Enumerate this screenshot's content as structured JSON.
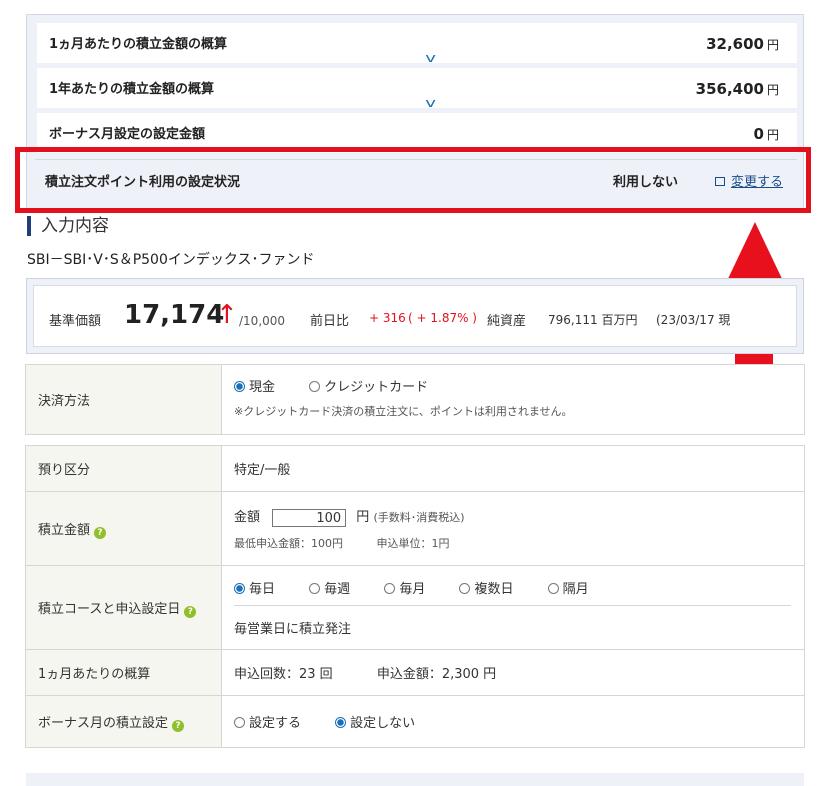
{
  "summary": {
    "monthly_label": "1ヵ月あたりの積立金額の概算",
    "monthly_value": "32,600",
    "yearly_label": "1年あたりの積立金額の概算",
    "yearly_value": "356,400",
    "bonus_label": "ボーナス月設定の設定金額",
    "bonus_value": "0",
    "yen": "円",
    "point_label": "積立注文ポイント利用の設定状況",
    "point_value": "利用しない",
    "point_link": "変更する"
  },
  "section": {
    "title": "入力内容",
    "fund_name": "SBI－SBI･V･S＆P500インデックス･ファンド"
  },
  "price": {
    "nav_label": "基準価額",
    "nav_value": "17,174",
    "arrow": "↑",
    "unit": "/10,000",
    "change_label": "前日比",
    "change_value": "+ 316",
    "change_pct": "( + 1.87% )",
    "assets_label": "純資産",
    "assets_value": "796,111 百万円",
    "date": "(23/03/17 現"
  },
  "payment": {
    "label": "決済方法",
    "opt_cash": "現金",
    "opt_card": "クレジットカード",
    "note": "※クレジットカード決済の積立注文に、ポイントは利用されません。"
  },
  "form": {
    "account_label": "預り区分",
    "account_value": "特定/一般",
    "amount_label": "積立金額",
    "amount_prefix": "金額",
    "amount_value": "100",
    "amount_suffix": "円",
    "amount_tax": "(手数料･消費税込)",
    "min_amount": "最低申込金額：100円",
    "unit_amount": "申込単位：1円",
    "course_label": "積立コースと申込設定日",
    "course_daily": "毎日",
    "course_weekly": "毎週",
    "course_monthly": "毎月",
    "course_multi": "複数日",
    "course_biweekly": "隔月",
    "course_note": "毎営業日に積立発注",
    "monthly_est_label": "1ヵ月あたりの概算",
    "monthly_count": "申込回数：23 回",
    "monthly_amount": "申込金額：2,300 円",
    "bonus_label": "ボーナス月の積立設定",
    "bonus_on": "設定する",
    "bonus_off": "設定しない",
    "help_mark": "?"
  }
}
